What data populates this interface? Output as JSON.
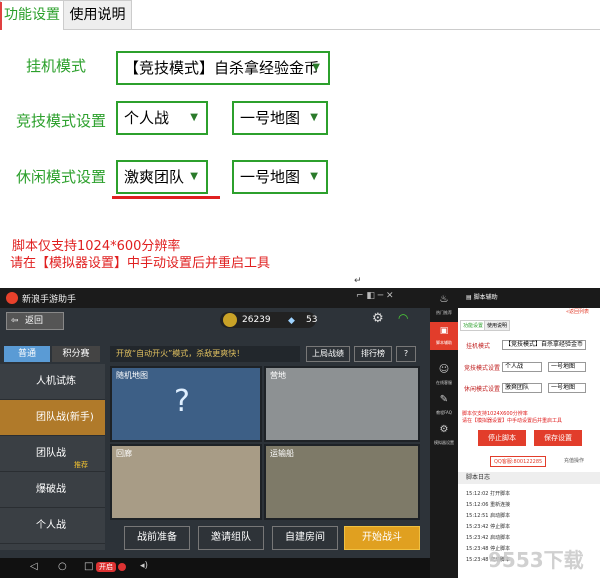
{
  "tabs": [
    {
      "label": "功能设置",
      "active": true
    },
    {
      "label": "使用说明",
      "active": false
    }
  ],
  "settings": {
    "hang_mode": {
      "label": "挂机模式",
      "value": "【竞技模式】自杀拿经验金币"
    },
    "competitive": {
      "label": "竞技模式设置",
      "mode": "个人战",
      "map": "一号地图"
    },
    "casual": {
      "label": "休闲模式设置",
      "mode": "激爽团队",
      "map": "一号地图"
    }
  },
  "notes": {
    "line1": "脚本仅支持1024*600分辨率",
    "line2": "请在【模拟器设置】中手动设置后并重启工具",
    "caret": "↵"
  },
  "emulator": {
    "title": "新浪手游助手",
    "android_pill": "开启"
  },
  "game": {
    "back_label": "返回",
    "coins": "26239",
    "diamonds": "53",
    "tabs": [
      "普通",
      "积分赛"
    ],
    "menu": [
      "人机试炼",
      "团队战(新手)",
      "团队战",
      "爆破战",
      "个人战"
    ],
    "menu_badge": "推荐",
    "announcement": "开放“自动开火”模式，杀敌更爽快！",
    "top_buttons": [
      "上局战绩",
      "排行榜",
      "?"
    ],
    "maps": [
      "随机地图",
      "营地",
      "回廊",
      "运输船"
    ],
    "random_symbol": "?",
    "bottom_buttons": [
      "战前准备",
      "邀请组队",
      "自建房间",
      "开始战斗"
    ]
  },
  "emu_sidebar": [
    "热门推荐",
    "脚本辅助",
    "在线客服",
    "教程FAQ",
    "模拟器设置"
  ],
  "helper": {
    "header": "脚本辅助",
    "back": "«返回列表",
    "tabs": [
      "功能设置",
      "使用说明"
    ],
    "rows": [
      {
        "label": "挂机模式",
        "value": "【竞技模式】自杀拿经验金币"
      },
      {
        "label": "竞技模式设置",
        "mode": "个人战",
        "map": "一号地图"
      },
      {
        "label": "休闲模式设置",
        "mode": "激爽团队",
        "map": "一号地图"
      }
    ],
    "note1": "脚本仅支持1024X600分辨率",
    "note2": "请在【模拟器设置】中手动设置后并重启工具",
    "stop": "停止脚本",
    "save": "保存设置",
    "qq": "QQ客服:800122285",
    "charge": "充值操作",
    "log_title": "脚本日志",
    "logs": [
      {
        "time": "15:12:02",
        "msg": "打开脚本"
      },
      {
        "time": "15:12:06",
        "msg": "重新连接"
      },
      {
        "time": "15:12:51",
        "msg": "启动脚本"
      },
      {
        "time": "15:23:42",
        "msg": "停止脚本"
      },
      {
        "time": "15:23:42",
        "msg": "启动脚本"
      },
      {
        "time": "15:23:48",
        "msg": "停止脚本"
      },
      {
        "time": "15:23:48",
        "msg": "启动脚本"
      }
    ]
  },
  "watermark": "9553下载"
}
